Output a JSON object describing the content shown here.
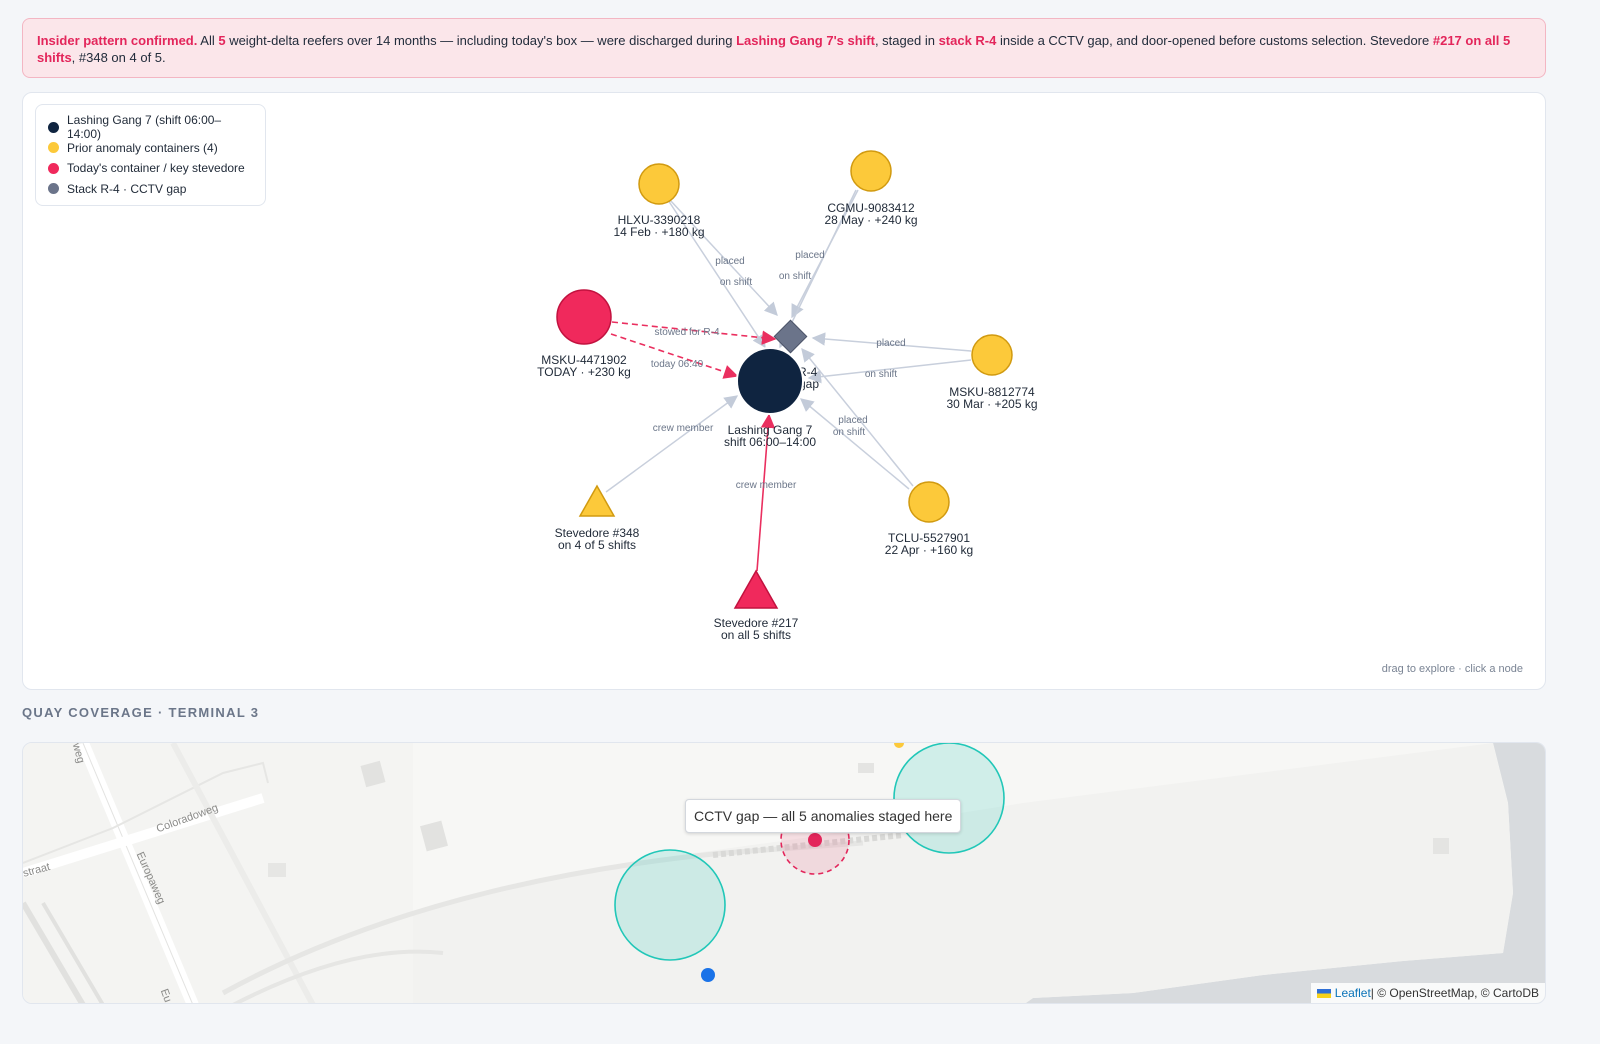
{
  "alert": {
    "p1": "Insider pattern confirmed.",
    "p2": " All ",
    "p3": "5",
    "p4": " weight-delta reefers over 14 months — including today's box — were discharged during ",
    "p5": "Lashing Gang 7's shift",
    "p6": ", staged in ",
    "p7": "stack R-4",
    "p8": " inside a CCTV gap, and door-opened before customs selection. Stevedore ",
    "p9": "#217 on all 5 shifts",
    "p10": ", #348 on 4 of 5."
  },
  "legend": [
    {
      "label": "Lashing Gang 7 (shift 06:00–14:00)",
      "color": "#0f2440"
    },
    {
      "label": "Prior anomaly containers (4)",
      "color": "#fcc93a"
    },
    {
      "label": "Today's container / key stevedore",
      "color": "#f0295c"
    },
    {
      "label": "Stack R-4 · CCTV gap",
      "color": "#6b748a"
    }
  ],
  "graph": {
    "hint": "drag to explore · click a node",
    "nodes": {
      "gang": {
        "line1": "Lashing Gang 7",
        "line2": "shift 06:00–14:00"
      },
      "stack": {
        "line1": "Stack R-4",
        "line2": "CCTV gap"
      },
      "hlxu": {
        "line1": "HLXU-3390218",
        "line2": "14 Feb · +180 kg"
      },
      "cgmu": {
        "line1": "CGMU-9083412",
        "line2": "28 May · +240 kg"
      },
      "msku_today": {
        "line1": "MSKU-4471902",
        "line2": "TODAY · +230 kg"
      },
      "msku_mar": {
        "line1": "MSKU-8812774",
        "line2": "30 Mar · +205 kg"
      },
      "tclu": {
        "line1": "TCLU-5527901",
        "line2": "22 Apr · +160 kg"
      },
      "st348": {
        "line1": "Stevedore #348",
        "line2": "on 4 of 5 shifts"
      },
      "st217": {
        "line1": "Stevedore #217",
        "line2": "on all 5 shifts"
      }
    },
    "edges": {
      "placed": "placed",
      "on_shift": "on shift",
      "stowed": "stowed for R-4",
      "today": "today 06:40",
      "crew": "crew member"
    }
  },
  "map": {
    "section_title": "QUAY COVERAGE · TERMINAL 3",
    "tooltip": "CCTV gap — all 5 anomalies staged here",
    "streets": {
      "coloradoweg": "Coloradoweg",
      "europaweg": "Europaweg",
      "straat": "straat",
      "weg": "weg",
      "eu": "Eu"
    },
    "attribution": {
      "leaflet": "Leaflet",
      "rest": " | © OpenStreetMap, © CartoDB"
    },
    "colors": {
      "camera": "#21c7b8",
      "gap": "#e3265b",
      "you": "#1a73e8"
    }
  }
}
